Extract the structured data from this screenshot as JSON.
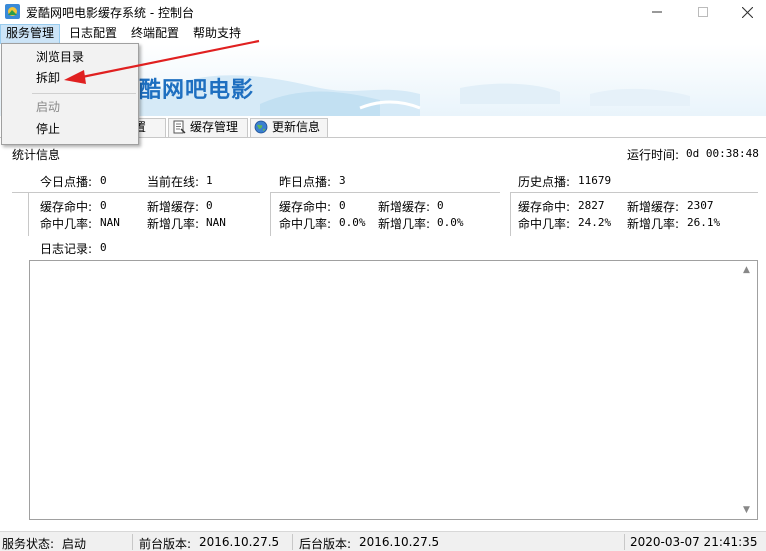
{
  "window": {
    "title": "爱酷网吧电影缓存系统 - 控制台",
    "icons": {
      "app": "app-icon",
      "minimize": "minimize-icon",
      "maximize": "maximize-icon",
      "close": "close-icon"
    }
  },
  "menubar": {
    "items": [
      {
        "label": "服务管理"
      },
      {
        "label": "日志配置"
      },
      {
        "label": "终端配置"
      },
      {
        "label": "帮助支持"
      }
    ]
  },
  "dropdown": {
    "items": [
      {
        "label": "浏览目录",
        "enabled": true
      },
      {
        "label": "拆卸",
        "enabled": true
      },
      {
        "label": "启动",
        "enabled": false
      },
      {
        "label": "停止",
        "enabled": true
      }
    ]
  },
  "banner": {
    "text": "爱酷网吧电影"
  },
  "tabs": [
    {
      "label": "配置",
      "icon": "config-icon"
    },
    {
      "label": "缓存管理",
      "icon": "cache-icon"
    },
    {
      "label": "更新信息",
      "icon": "globe-icon"
    }
  ],
  "stats": {
    "title": "统计信息",
    "run_time_label": "运行时间:",
    "run_time_value": "0d 00:38:48",
    "today": {
      "plays_label": "今日点播:",
      "plays": "0",
      "online_label": "当前在线:",
      "online": "1",
      "cache_hit_label": "缓存命中:",
      "cache_hit": "0",
      "new_cache_label": "新增缓存:",
      "new_cache": "0",
      "hit_rate_label": "命中几率:",
      "hit_rate": "NAN",
      "new_rate_label": "新增几率:",
      "new_rate": "NAN"
    },
    "yesterday": {
      "plays_label": "昨日点播:",
      "plays": "3",
      "cache_hit_label": "缓存命中:",
      "cache_hit": "0",
      "new_cache_label": "新增缓存:",
      "new_cache": "0",
      "hit_rate_label": "命中几率:",
      "hit_rate": "0.0%",
      "new_rate_label": "新增几率:",
      "new_rate": "0.0%"
    },
    "history": {
      "plays_label": "历史点播:",
      "plays": "11679",
      "cache_hit_label": "缓存命中:",
      "cache_hit": "2827",
      "new_cache_label": "新增缓存:",
      "new_cache": "2307",
      "hit_rate_label": "命中几率:",
      "hit_rate": "24.2%",
      "new_rate_label": "新增几率:",
      "new_rate": "26.1%"
    },
    "log_label": "日志记录:",
    "log_count": "0"
  },
  "statusbar": {
    "service_status_label": "服务状态:",
    "service_status": "启动",
    "frontend_version_label": "前台版本:",
    "frontend_version": "2016.10.27.5",
    "backend_version_label": "后台版本:",
    "backend_version": "2016.10.27.5",
    "datetime": "2020-03-07 21:41:35"
  },
  "colors": {
    "menu_highlight": "#cce4f7",
    "banner_text": "#1e6fc0",
    "annotation_arrow": "#e02020"
  }
}
